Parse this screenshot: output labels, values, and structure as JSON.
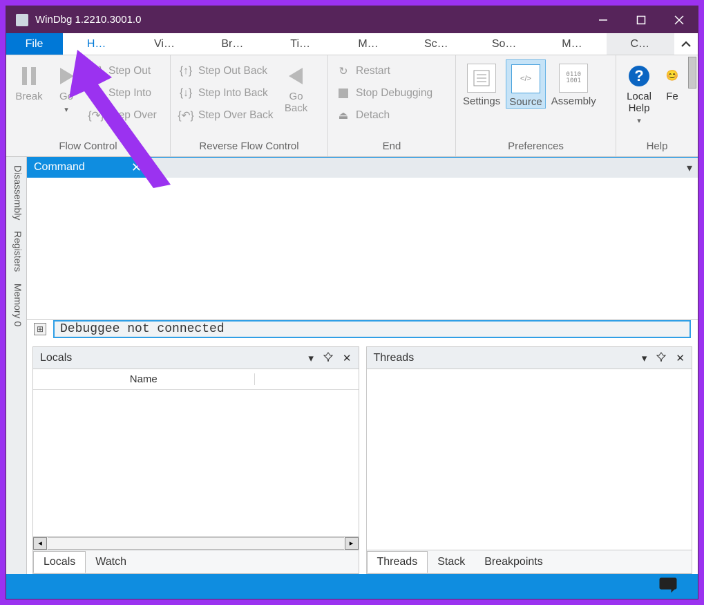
{
  "window": {
    "title": "WinDbg 1.2210.3001.0"
  },
  "ribbon_tabs": {
    "file": "File",
    "items": [
      "H…",
      "Vi…",
      "Br…",
      "Ti…",
      "M…",
      "Sc…",
      "So…",
      "M…",
      "C…"
    ],
    "active_index": 0,
    "hover_index": 8
  },
  "ribbon": {
    "break": "Break",
    "go": "Go",
    "flow": {
      "step_out": "Step Out",
      "step_into": "Step Into",
      "step_over": "Step Over",
      "caption": "Flow Control"
    },
    "rev": {
      "step_out_back": "Step Out Back",
      "step_into_back": "Step Into Back",
      "step_over_back": "Step Over Back",
      "go_back": "Go\nBack",
      "caption": "Reverse Flow Control"
    },
    "end": {
      "restart": "Restart",
      "stop": "Stop Debugging",
      "detach": "Detach",
      "caption": "End"
    },
    "prefs": {
      "settings": "Settings",
      "source": "Source",
      "assembly": "Assembly",
      "caption": "Preferences"
    },
    "help": {
      "local_help": "Local Help",
      "feedback": "Fe",
      "caption": "Help"
    }
  },
  "side_tabs": [
    "Disassembly",
    "Registers",
    "Memory 0"
  ],
  "command": {
    "title": "Command",
    "placeholder": "Debuggee not connected"
  },
  "locals": {
    "title": "Locals",
    "column": "Name",
    "tabs": [
      "Locals",
      "Watch"
    ],
    "active_tab": 0
  },
  "threads": {
    "title": "Threads",
    "tabs": [
      "Threads",
      "Stack",
      "Breakpoints"
    ],
    "active_tab": 0
  },
  "colors": {
    "accent": "#0f8de0",
    "titlebar": "#56245a",
    "annotation": "#9b32f0"
  }
}
